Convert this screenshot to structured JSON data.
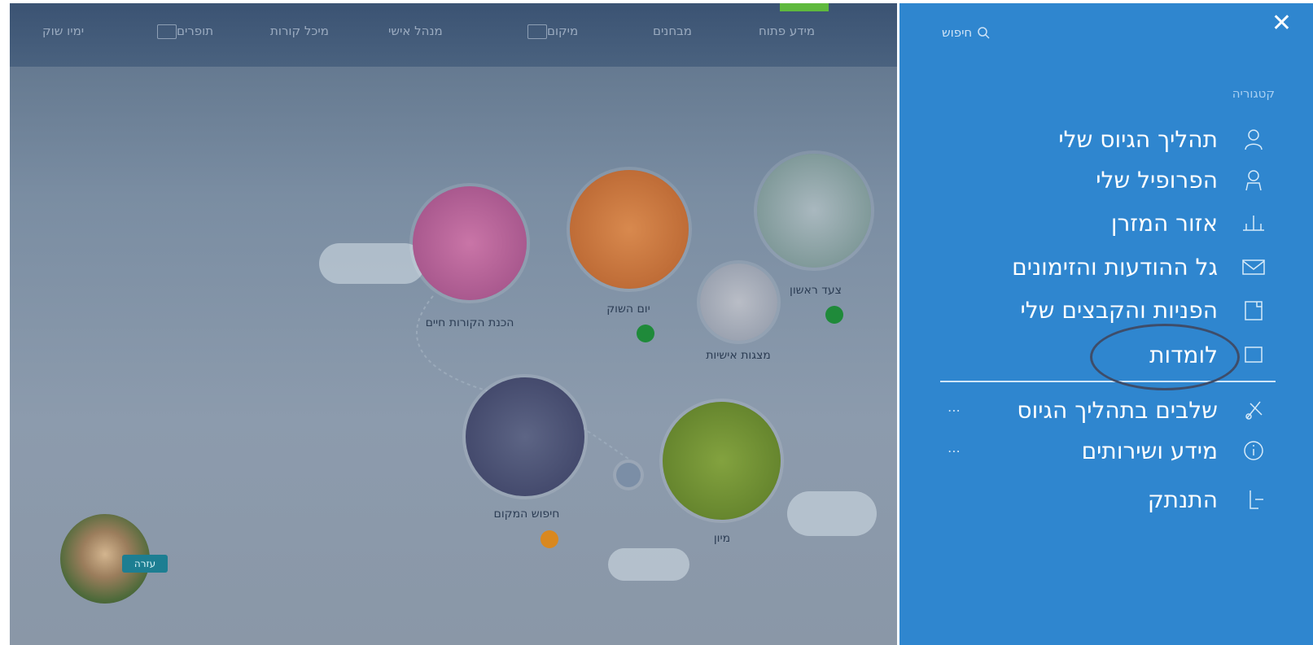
{
  "topbar": {
    "items": [
      "ימיו שוק",
      "תופרים",
      "מיכל קורות",
      "מנהל אישי",
      "מיקום",
      "מבחנים",
      "מידע פתוח"
    ]
  },
  "background": {
    "nodes": [
      {
        "label": "הכנת הקורות חיים"
      },
      {
        "label": "יום השוק"
      },
      {
        "label": "מצגות אישיות"
      },
      {
        "label": "צעד ראשון"
      },
      {
        "label": "חיפוש המקום"
      },
      {
        "label": "מיון"
      }
    ],
    "avatar_badge": "עזרה"
  },
  "panel": {
    "close_label": "✕",
    "search_label": "חיפוש",
    "section_title": "קטגוריה",
    "menu": [
      {
        "label": "תהליך הגיוס שלי",
        "icon": "user-icon"
      },
      {
        "label": "הפרופיל שלי",
        "icon": "profile-icon"
      },
      {
        "label": "אזור המזרן",
        "icon": "trainer-icon"
      },
      {
        "label": "גל ההודעות והזימונים",
        "icon": "mail-icon"
      },
      {
        "label": "הפניות והקבצים שלי",
        "icon": "folder-icon"
      },
      {
        "label": "לומדות",
        "icon": "book-icon"
      },
      {
        "label": "שלבים בתהליך הגיוס",
        "icon": "steps-icon",
        "more": "⋯"
      },
      {
        "label": "מידע ושירותים",
        "icon": "info-icon",
        "more": "⋯"
      },
      {
        "label": "התנתק",
        "icon": "logout-icon"
      }
    ]
  },
  "colors": {
    "panel": "#2f86cf",
    "highlight": "#3e4d6a",
    "accent_green": "#5fb93d"
  }
}
